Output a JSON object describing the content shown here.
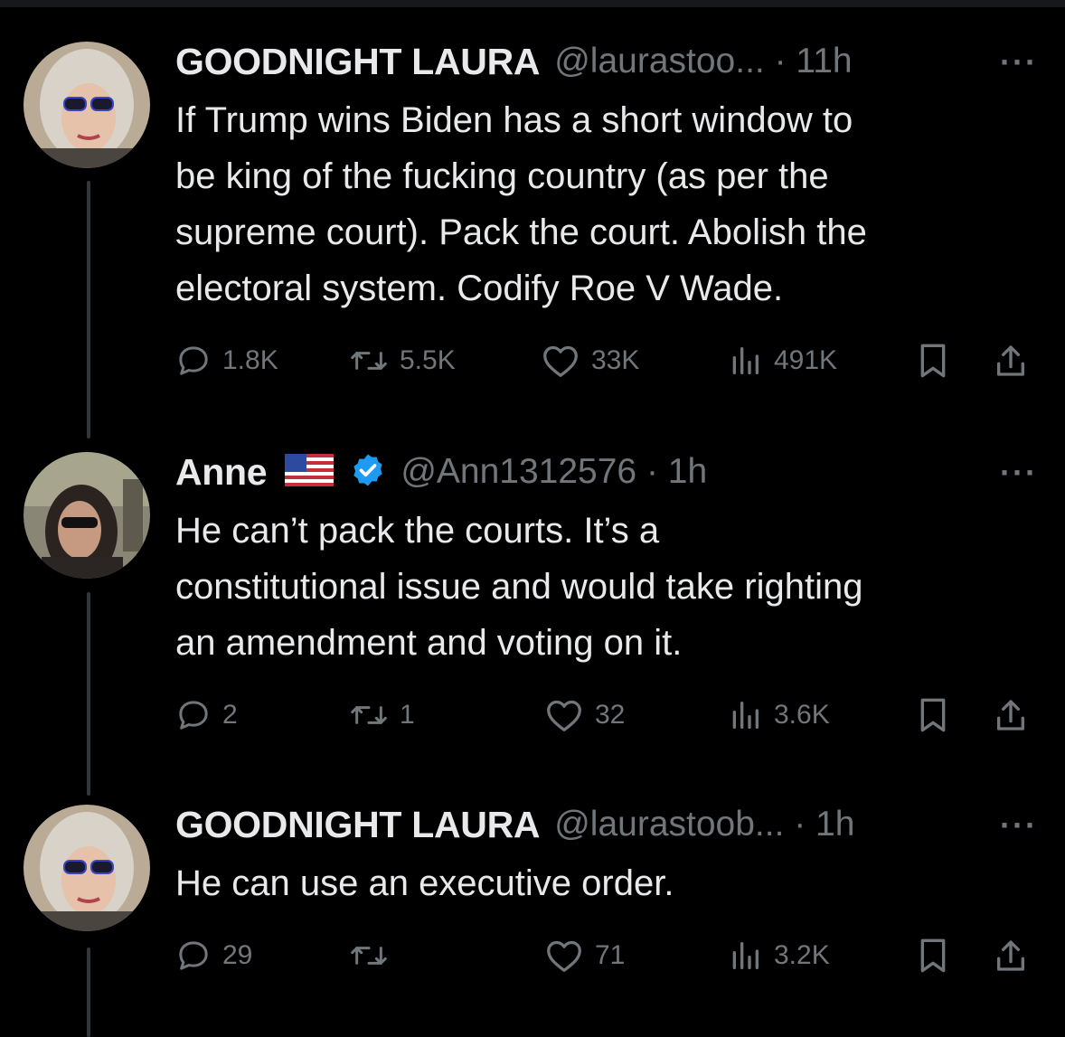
{
  "tweets": [
    {
      "name": "GOODNIGHT LAURA",
      "handle": "@laurastoo... · 11h",
      "more": "···",
      "text": "If Trump wins Biden has a short window to\nbe king of the fucking country (as per the\nsupreme court). Pack the court. Abolish the\nelectoral system. Codify Roe V Wade.",
      "replies": "1.8K",
      "reposts": "5.5K",
      "likes": "33K",
      "views": "491K"
    },
    {
      "name": "Anne",
      "handle": "@Ann1312576 · 1h",
      "more": "···",
      "text": "He can’t pack the courts. It’s a\nconstitutional issue and would take righting\nan amendment and voting on it.",
      "replies": "2",
      "reposts": "1",
      "likes": "32",
      "views": "3.6K"
    },
    {
      "name": "GOODNIGHT LAURA",
      "handle": "@laurastoob... · 1h",
      "more": "···",
      "text": "He can use an executive order.",
      "replies": "29",
      "reposts": "",
      "likes": "71",
      "views": "3.2K"
    }
  ],
  "icons": {
    "reply": "speech-bubble-icon",
    "repost": "repost-arrows-icon",
    "like": "heart-icon",
    "views": "bar-chart-icon",
    "bookmark": "bookmark-icon",
    "share": "share-upload-icon",
    "flag": "us-flag-icon",
    "verified": "verified-badge-icon"
  },
  "colors": {
    "background": "#000000",
    "text": "#e7e9ea",
    "muted": "#71767b",
    "verified": "#1d9bf0",
    "thread_line": "#333639"
  }
}
